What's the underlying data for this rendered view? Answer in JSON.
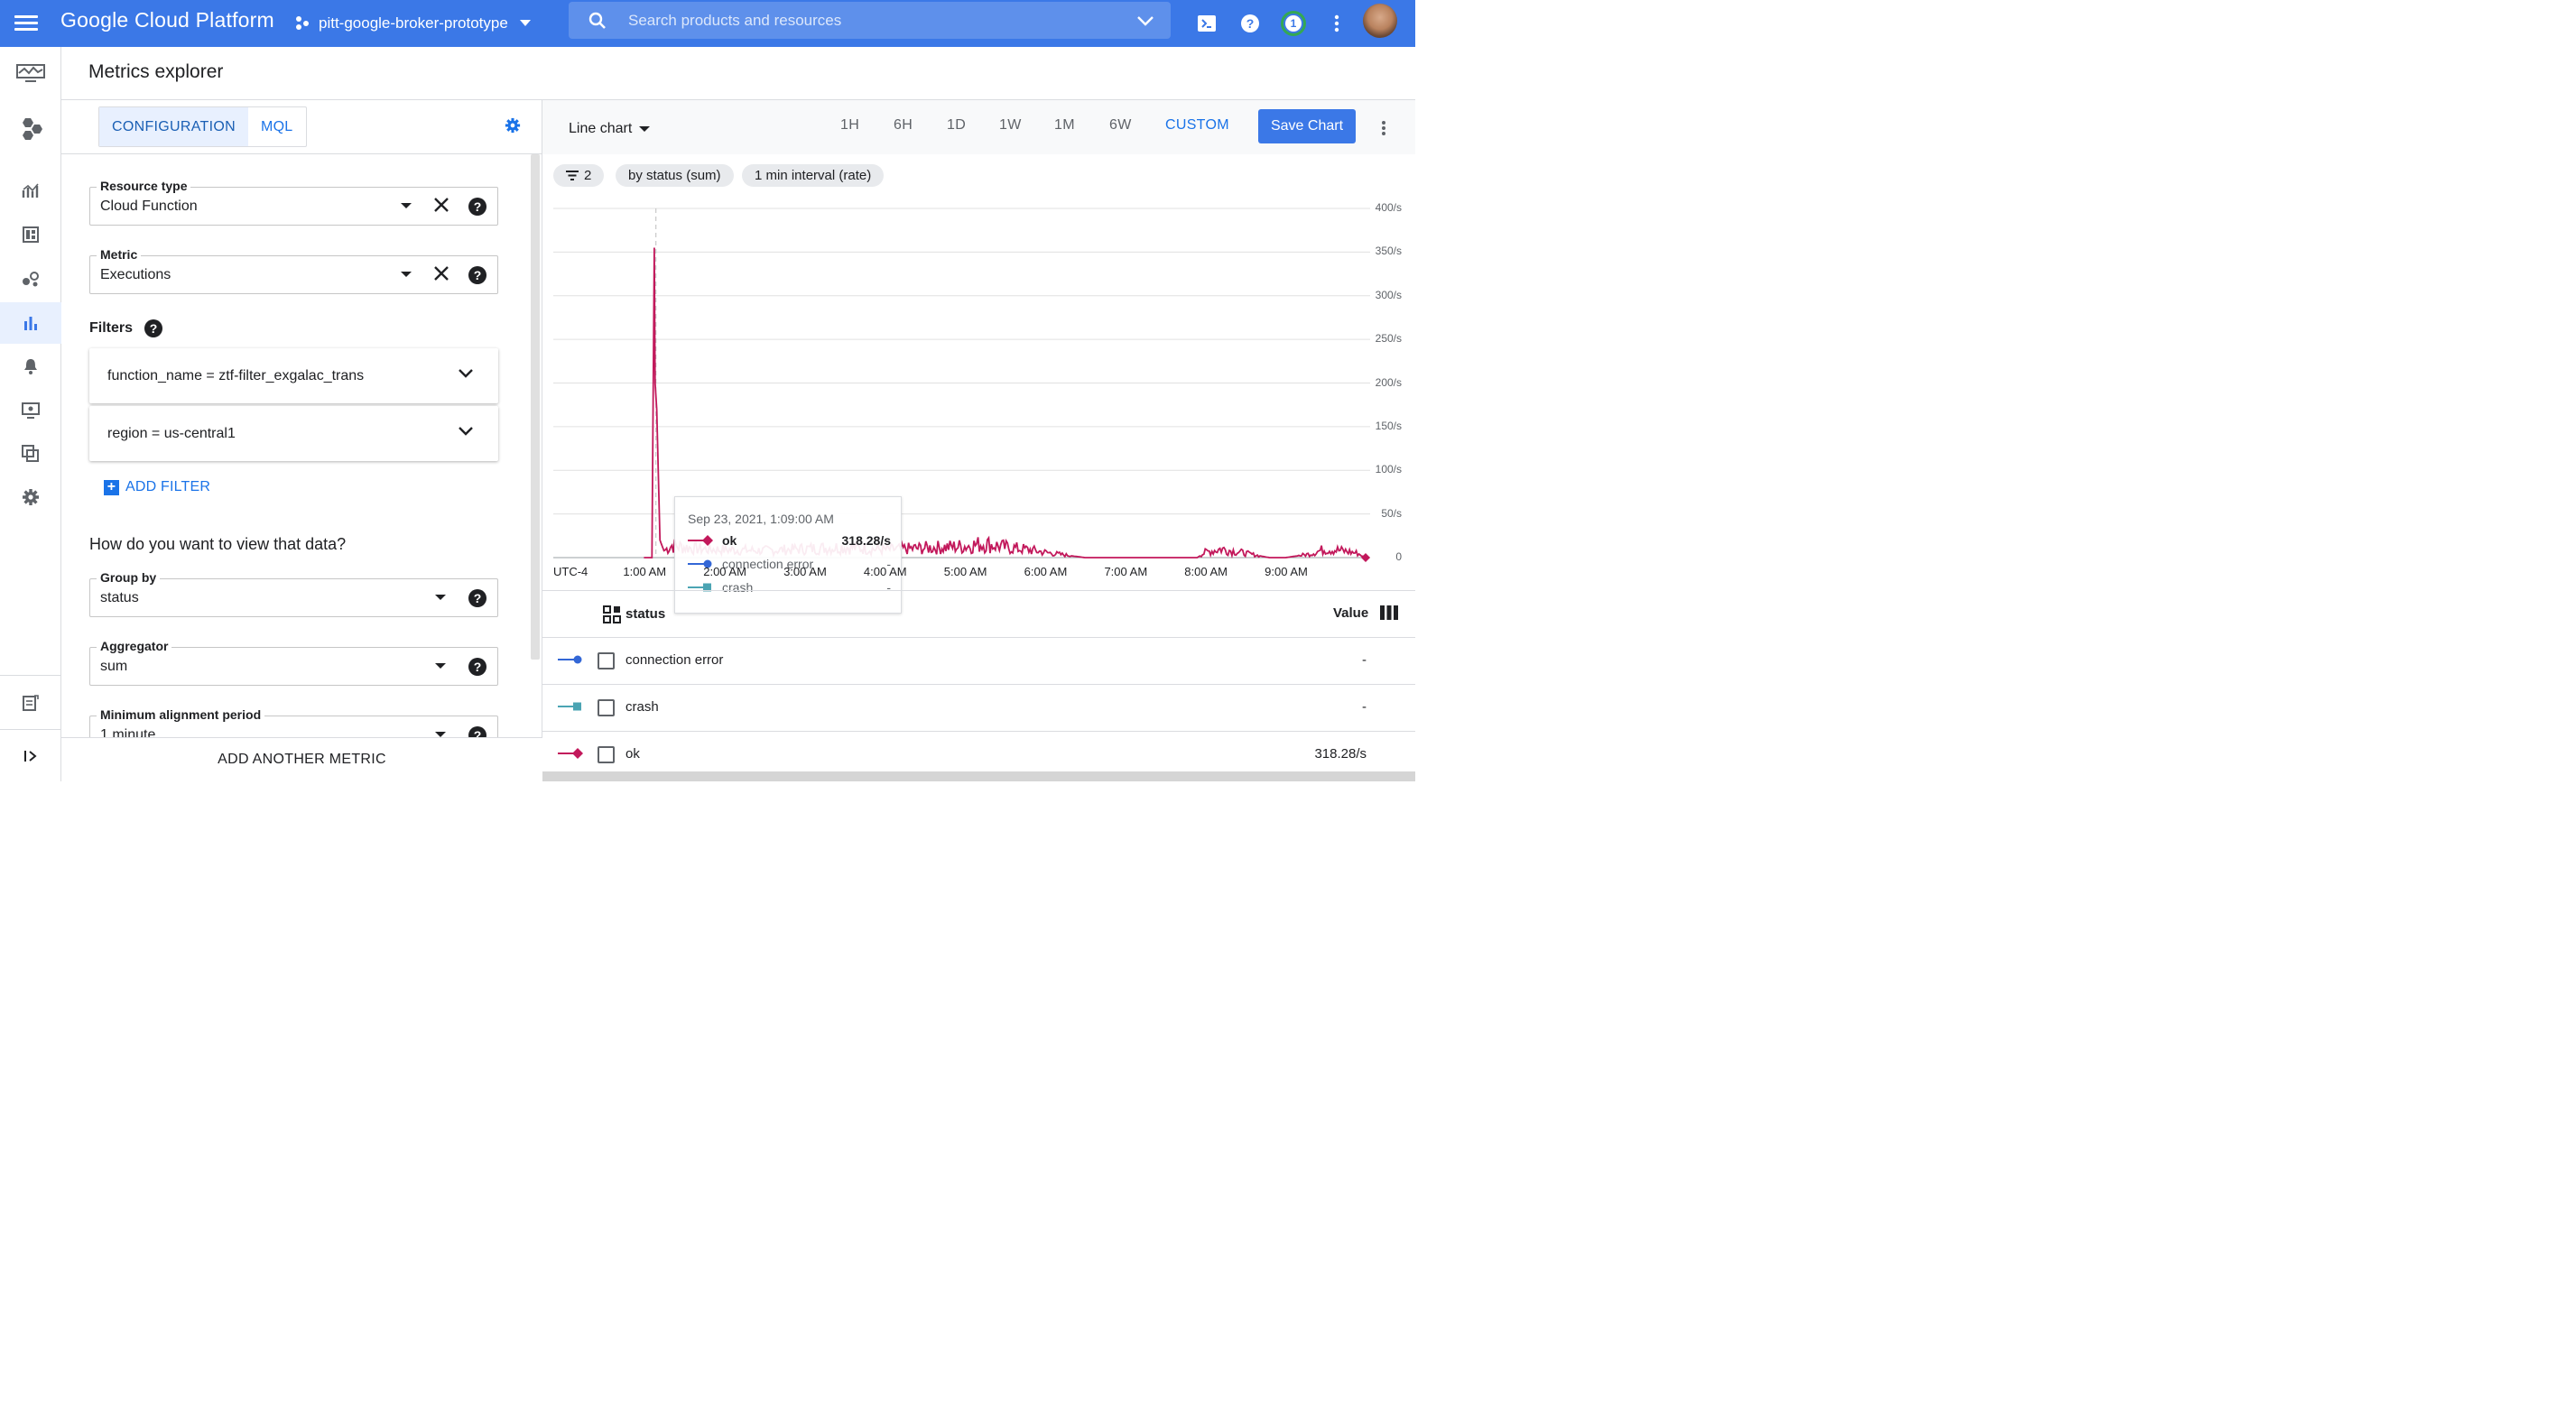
{
  "app": {
    "brand": "Google Cloud Platform",
    "project": "pitt-google-broker-prototype",
    "search_placeholder": "Search products and resources",
    "notif_count": "1"
  },
  "page": {
    "title": "Metrics explorer"
  },
  "config": {
    "tabs": [
      "CONFIGURATION",
      "MQL"
    ],
    "resource": {
      "label": "Resource type",
      "value": "Cloud Function"
    },
    "metric": {
      "label": "Metric",
      "value": "Executions"
    },
    "filters_heading": "Filters",
    "filters": [
      "function_name = ztf-filter_exgalac_trans",
      "region = us-central1"
    ],
    "add_filter": "ADD FILTER",
    "view_heading": "How do you want to view that data?",
    "group_by": {
      "label": "Group by",
      "value": "status"
    },
    "aggregator": {
      "label": "Aggregator",
      "value": "sum"
    },
    "alignment": {
      "label": "Minimum alignment period",
      "value": "1 minute"
    },
    "add_metric": "ADD ANOTHER METRIC"
  },
  "chart_bar": {
    "chart_type": "Line chart",
    "ranges": [
      "1H",
      "6H",
      "1D",
      "1W",
      "1M",
      "6W",
      "CUSTOM"
    ],
    "active_range": "CUSTOM",
    "save": "Save Chart",
    "chips": [
      "2",
      "by status (sum)",
      "1 min interval (rate)"
    ]
  },
  "chart_data": {
    "type": "line",
    "timezone": "UTC-4",
    "x_ticks": [
      "1:00 AM",
      "2:00 AM",
      "3:00 AM",
      "4:00 AM",
      "5:00 AM",
      "6:00 AM",
      "7:00 AM",
      "8:00 AM",
      "9:00 AM"
    ],
    "y_ticks": [
      "400/s",
      "350/s",
      "300/s",
      "250/s",
      "200/s",
      "150/s",
      "100/s",
      "50/s",
      "0"
    ],
    "ylim": [
      0,
      400
    ],
    "series": [
      {
        "name": "ok",
        "color": "#c2185b",
        "marker": "diamond",
        "x_hours": [
          0.0,
          0.1,
          0.13,
          0.14,
          0.16,
          0.2,
          0.25,
          0.35,
          0.5,
          0.7,
          1.0,
          1.5,
          2.0,
          2.5,
          3.0,
          3.5,
          4.0,
          4.25,
          4.5,
          4.8,
          5.0,
          5.5,
          5.8,
          6.0,
          6.5,
          6.9,
          7.0,
          7.2,
          7.5,
          7.8,
          8.0,
          8.3,
          8.5,
          8.7,
          8.9,
          9.0
        ],
        "values": [
          0,
          0,
          355,
          200,
          170,
          20,
          8,
          14,
          12,
          10,
          9,
          8,
          10,
          12,
          9,
          11,
          13,
          16,
          12,
          9,
          6,
          0,
          0,
          0,
          0,
          0,
          6,
          10,
          5,
          0,
          0,
          4,
          10,
          8,
          5,
          0
        ]
      },
      {
        "name": "connection error",
        "color": "#3367d6",
        "marker": "circle",
        "values": []
      },
      {
        "name": "crash",
        "color": "#4ba4b3",
        "marker": "square",
        "values": []
      }
    ]
  },
  "tooltip": {
    "time": "Sep 23, 2021, 1:09:00 AM",
    "rows": [
      {
        "name": "ok",
        "value": "318.28/s"
      },
      {
        "name": "connection error",
        "value": "-"
      },
      {
        "name": "crash",
        "value": "-"
      }
    ]
  },
  "legend": {
    "col_status": "status",
    "col_value": "Value",
    "rows": [
      {
        "name": "connection error",
        "value": "-"
      },
      {
        "name": "crash",
        "value": "-"
      },
      {
        "name": "ok",
        "value": "318.28/s"
      }
    ]
  }
}
